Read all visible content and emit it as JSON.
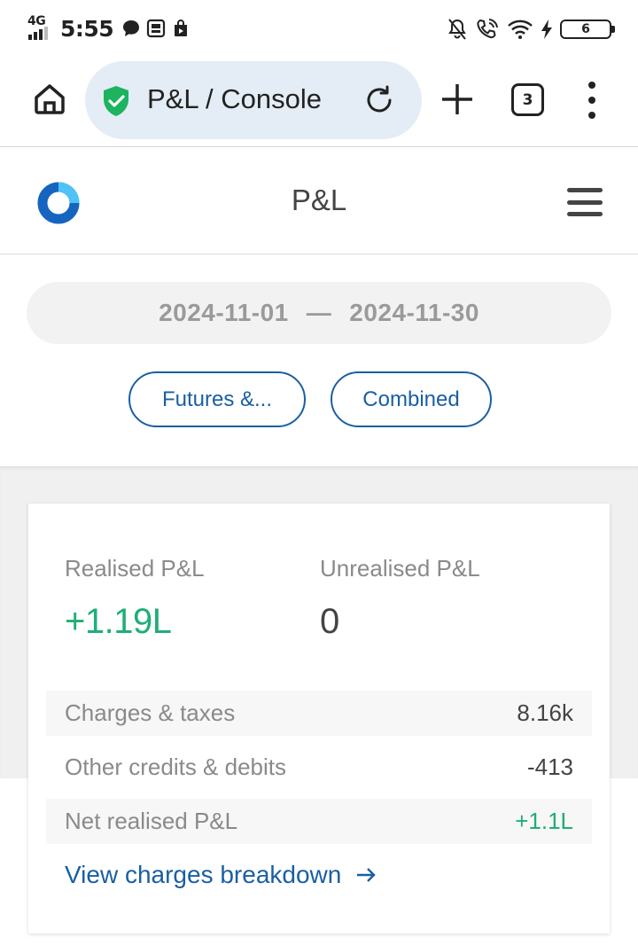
{
  "status_bar": {
    "network": "4G",
    "time": "5:55",
    "battery": "6"
  },
  "browser": {
    "url_title": "P&L / Console",
    "tab_count": "3"
  },
  "app": {
    "title": "P&L"
  },
  "filters": {
    "date_from": "2024-11-01",
    "date_separator": "—",
    "date_to": "2024-11-30",
    "segment_chip": "Futures &...",
    "type_chip": "Combined"
  },
  "summary": {
    "realised_label": "Realised P&L",
    "realised_value": "+1.19L",
    "unrealised_label": "Unrealised P&L",
    "unrealised_value": "0",
    "rows": [
      {
        "label": "Charges & taxes",
        "value": "8.16k"
      },
      {
        "label": "Other credits & debits",
        "value": "-413"
      },
      {
        "label": "Net realised P&L",
        "value": "+1.1L"
      }
    ],
    "breakdown_link": "View charges breakdown"
  },
  "colors": {
    "profit_green": "#1fae77",
    "link_blue": "#1a5fa3",
    "url_pill_bg": "#e4ecf5",
    "shield_green": "#1db35f"
  }
}
